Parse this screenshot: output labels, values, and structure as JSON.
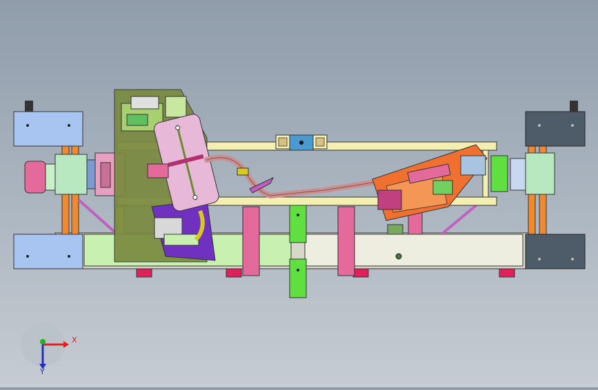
{
  "viewport": {
    "background_top": "#8f9caa",
    "background_bottom": "#c7ccd3"
  },
  "triad": {
    "x_label": "X",
    "y_label": "Y",
    "x_color": "#e02020",
    "y_color": "#2030c0",
    "z_color": "#20b020"
  },
  "colors": {
    "frame_yellow": "#f2efb0",
    "base_green": "#c8f0b0",
    "base_light": "#eeeee0",
    "block_blue": "#a8c4f0",
    "block_dark": "#4e5c6a",
    "pink": "#e36a9a",
    "rod_orange": "#f08a30",
    "clamp_orange": "#f07030",
    "olive": "#7a8a40",
    "purple": "#7030c0",
    "cylinder": "#e8b8d8",
    "pipe": "#c89090",
    "green_bright": "#60e040",
    "teal_motor": "#b8e8c0"
  }
}
